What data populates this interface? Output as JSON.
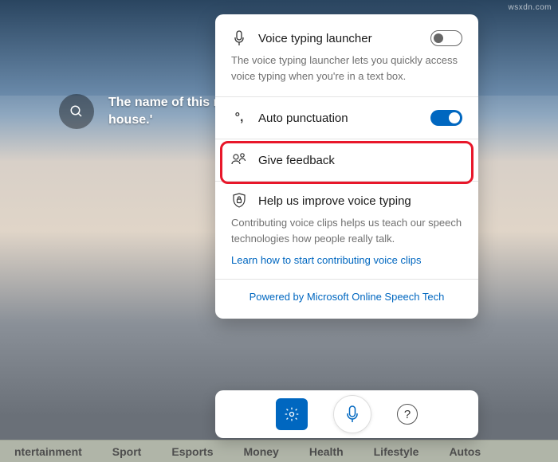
{
  "watermark": "wsxdn.com",
  "search": {
    "prompt_line1": "The name of this m",
    "prompt_line2": "house.'"
  },
  "panel": {
    "launcher": {
      "title": "Voice typing launcher",
      "desc": "The voice typing launcher lets you quickly access voice typing when you're in a text box.",
      "enabled": false
    },
    "autopunct": {
      "title": "Auto punctuation",
      "enabled": true
    },
    "feedback": {
      "title": "Give feedback"
    },
    "improve": {
      "title": "Help us improve voice typing",
      "desc": "Contributing voice clips helps us teach our speech technologies how people really talk.",
      "link": "Learn how to start contributing voice clips"
    },
    "footer": "Powered by Microsoft Online Speech Tech"
  },
  "newsbar": [
    "ntertainment",
    "Sport",
    "Esports",
    "Money",
    "Health",
    "Lifestyle",
    "Autos"
  ]
}
